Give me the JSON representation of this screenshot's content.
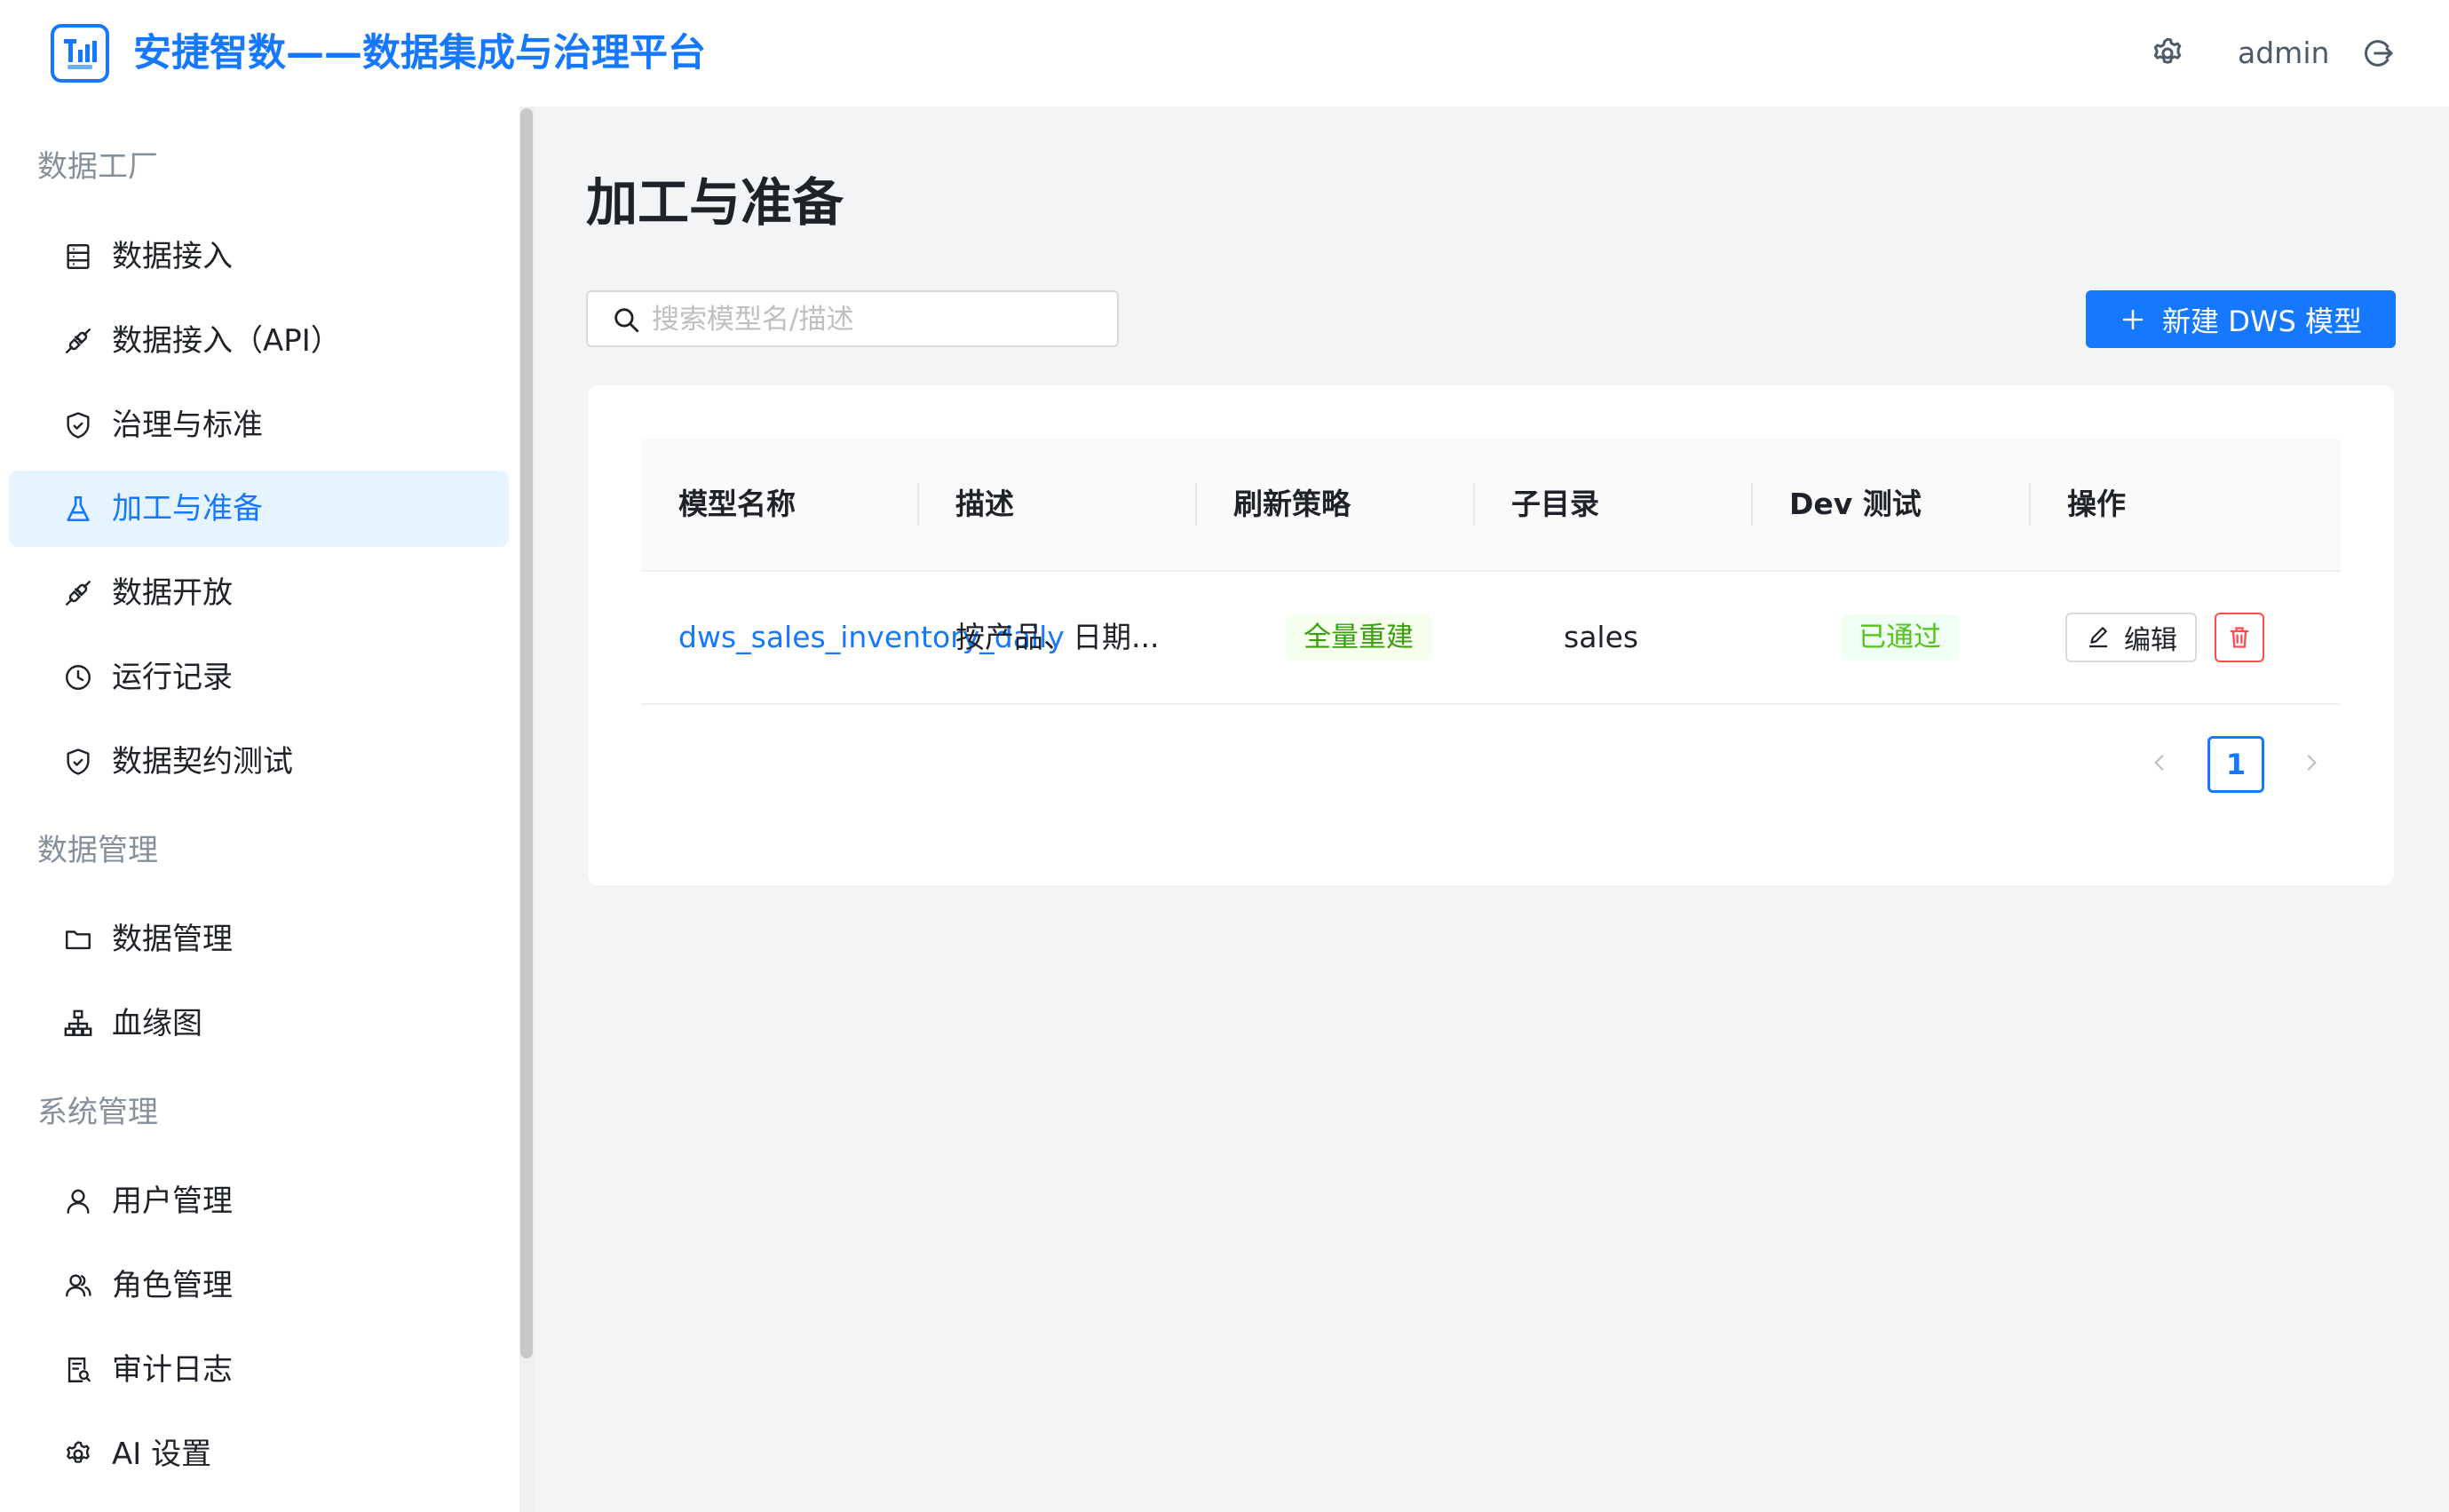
{
  "header": {
    "title": "安捷智数——数据集成与治理平台",
    "logo_text": "TnI",
    "user": "admin"
  },
  "sidebar": {
    "groups": [
      {
        "title": "数据工厂",
        "items": [
          {
            "label": "数据接入",
            "icon": "database-icon"
          },
          {
            "label": "数据接入（API）",
            "icon": "api-icon"
          },
          {
            "label": "治理与标准",
            "icon": "shield-check-icon"
          },
          {
            "label": "加工与准备",
            "icon": "flask-icon",
            "active": true
          },
          {
            "label": "数据开放",
            "icon": "api-icon"
          },
          {
            "label": "运行记录",
            "icon": "clock-icon"
          },
          {
            "label": "数据契约测试",
            "icon": "shield-check-icon"
          }
        ]
      },
      {
        "title": "数据管理",
        "items": [
          {
            "label": "数据管理",
            "icon": "folder-icon"
          },
          {
            "label": "血缘图",
            "icon": "lineage-icon"
          }
        ]
      },
      {
        "title": "系统管理",
        "items": [
          {
            "label": "用户管理",
            "icon": "user-icon"
          },
          {
            "label": "角色管理",
            "icon": "users-icon"
          },
          {
            "label": "审计日志",
            "icon": "audit-icon"
          },
          {
            "label": "AI 设置",
            "icon": "gear-icon"
          }
        ]
      }
    ]
  },
  "main": {
    "title": "加工与准备",
    "search_placeholder": "搜索模型名/描述",
    "search_value": "",
    "new_button": "新建 DWS 模型",
    "table": {
      "columns": [
        "模型名称",
        "描述",
        "刷新策略",
        "子目录",
        "Dev 测试",
        "操作"
      ],
      "rows": [
        {
          "name": "dws_sales_inventory_daily",
          "description": "按产品、日期...",
          "refresh": "全量重建",
          "subdir": "sales",
          "dev_test": "已通过",
          "edit_label": "编辑"
        }
      ]
    },
    "pagination": {
      "current": "1"
    }
  },
  "colors": {
    "primary": "#1677ff",
    "danger": "#ff4d4f",
    "success": "#52c41a",
    "tag_green_text": "#389e0d"
  }
}
